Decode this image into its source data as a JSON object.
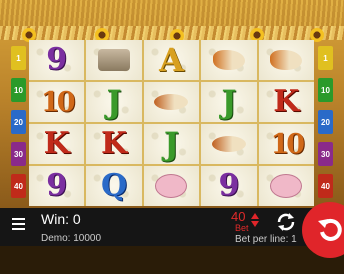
{
  "reels": [
    [
      "9",
      "cow",
      "A",
      "rooster",
      "rooster"
    ],
    [
      "10",
      "J",
      "chicken",
      "J",
      "K"
    ],
    [
      "K",
      "K",
      "J",
      "chicken",
      "10"
    ],
    [
      "9",
      "Q",
      "pig",
      "9",
      "pig"
    ]
  ],
  "paylines": {
    "values": [
      "1",
      "10",
      "20",
      "30",
      "40"
    ],
    "colors": [
      "#e0c020",
      "#2a9a2a",
      "#2a6ac8",
      "#8a2a8a",
      "#c02a1a"
    ]
  },
  "hud": {
    "win_label": "Win: 0",
    "demo_label": "Demo: 10000",
    "bet_value": "40",
    "bet_label": "Bet",
    "bet_per_line": "Bet per line: 1"
  },
  "colors": {
    "accent": "#e0252a",
    "hud_bg": "#151515"
  }
}
